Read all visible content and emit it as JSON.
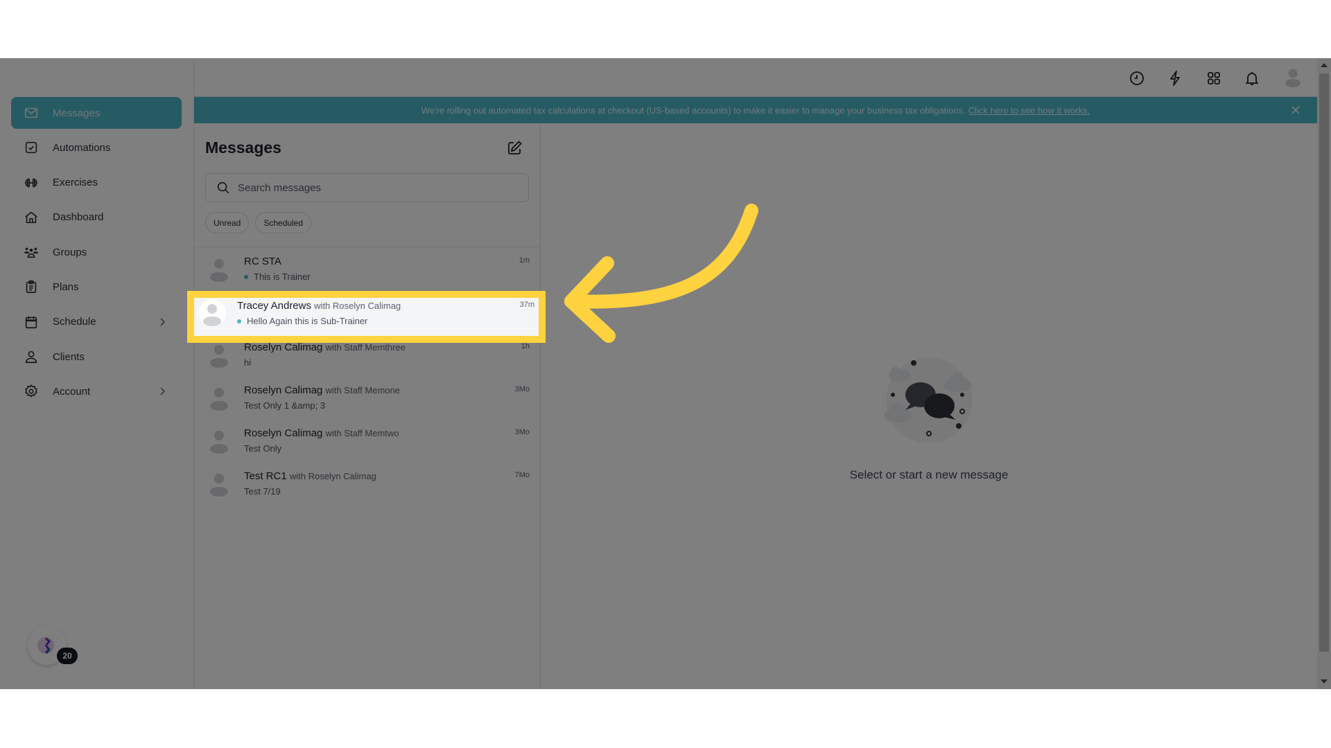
{
  "sidebar": {
    "items": [
      {
        "label": "Messages",
        "icon": "envelope-icon",
        "active": true
      },
      {
        "label": "Automations",
        "icon": "checkbox-icon"
      },
      {
        "label": "Exercises",
        "icon": "dumbbell-icon"
      },
      {
        "label": "Dashboard",
        "icon": "home-icon"
      },
      {
        "label": "Groups",
        "icon": "users-icon"
      },
      {
        "label": "Plans",
        "icon": "clipboard-icon"
      },
      {
        "label": "Schedule",
        "icon": "calendar-icon",
        "has_submenu": true
      },
      {
        "label": "Clients",
        "icon": "user-icon"
      },
      {
        "label": "Account",
        "icon": "gear-icon",
        "has_submenu": true
      }
    ],
    "fab_badge": "20"
  },
  "topbar": {
    "icons": [
      "clock-icon",
      "lightning-icon",
      "apps-grid-icon",
      "bell-icon",
      "user-avatar-icon"
    ]
  },
  "banner": {
    "text": "We're rolling out automated tax calculations at checkout (US-based accounts) to make it easier to manage your business tax obligations.",
    "link": "Click here to see how it works."
  },
  "messages": {
    "title": "Messages",
    "search_placeholder": "Search messages",
    "filters": [
      "Unread",
      "Scheduled"
    ],
    "threads": [
      {
        "name": "RC STA",
        "with": "",
        "preview": "This is Trainer",
        "time": "1m",
        "unread": true
      },
      {
        "name": "Tracey Andrews",
        "with": "with Roselyn Calimag",
        "preview": "Hello Again this is Sub-Trainer",
        "time": "37m",
        "unread": true,
        "highlighted": true
      },
      {
        "name": "Roselyn Calimag",
        "with": "with Staff Memthree",
        "preview": "hi",
        "time": "1h",
        "unread": false
      },
      {
        "name": "Roselyn Calimag",
        "with": "with Staff Memone",
        "preview": "Test Only 1 &amp; 3",
        "time": "3Mo",
        "unread": false
      },
      {
        "name": "Roselyn Calimag",
        "with": "with Staff Memtwo",
        "preview": "Test Only",
        "time": "3Mo",
        "unread": false
      },
      {
        "name": "Test RC1",
        "with": "with Roselyn Calimag",
        "preview": "Test 7/19",
        "time": "7Mo",
        "unread": false
      }
    ]
  },
  "detail": {
    "empty_text": "Select or start a new message"
  },
  "colors": {
    "accent": "#4fb6c8",
    "highlight": "#ffd23f"
  }
}
